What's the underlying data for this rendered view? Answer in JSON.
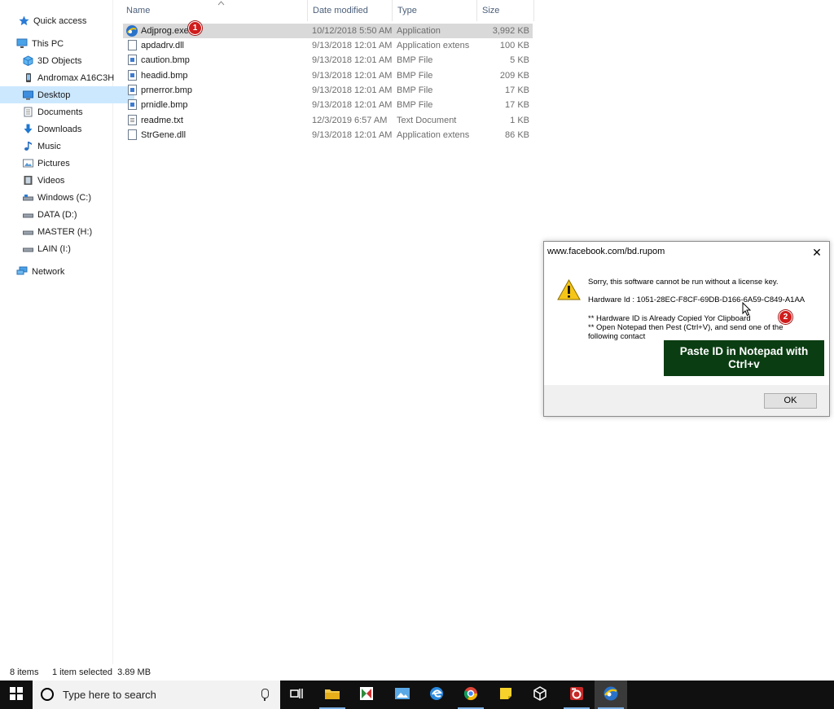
{
  "nav": {
    "items": [
      {
        "label": "Quick access",
        "icon": "star-icon"
      },
      {
        "label": "This PC",
        "icon": "computer-icon"
      },
      {
        "label": "3D Objects",
        "icon": "cube-icon"
      },
      {
        "label": "Andromax A16C3H",
        "icon": "phone-icon"
      },
      {
        "label": "Desktop",
        "icon": "desktop-icon",
        "selected": true
      },
      {
        "label": "Documents",
        "icon": "document-icon"
      },
      {
        "label": "Downloads",
        "icon": "download-arrow-icon"
      },
      {
        "label": "Music",
        "icon": "music-note-icon"
      },
      {
        "label": "Pictures",
        "icon": "pictures-icon"
      },
      {
        "label": "Videos",
        "icon": "film-icon"
      },
      {
        "label": "Windows (C:)",
        "icon": "drive-icon"
      },
      {
        "label": "DATA (D:)",
        "icon": "drive-icon"
      },
      {
        "label": "MASTER (H:)",
        "icon": "drive-icon"
      },
      {
        "label": "LAIN (I:)",
        "icon": "drive-icon"
      },
      {
        "label": "Network",
        "icon": "network-icon"
      }
    ]
  },
  "files": {
    "columns": {
      "name": "Name",
      "date": "Date modified",
      "type": "Type",
      "size": "Size"
    },
    "rows": [
      {
        "name": "Adjprog.exe",
        "date": "10/12/2018 5:50 AM",
        "type": "Application",
        "size": "3,992 KB",
        "icon": "app-icon",
        "selected": true
      },
      {
        "name": "apdadrv.dll",
        "date": "9/13/2018 12:01 AM",
        "type": "Application extens",
        "size": "100 KB",
        "icon": "dll-icon"
      },
      {
        "name": "caution.bmp",
        "date": "9/13/2018 12:01 AM",
        "type": "BMP File",
        "size": "5 KB",
        "icon": "bmp-icon"
      },
      {
        "name": "headid.bmp",
        "date": "9/13/2018 12:01 AM",
        "type": "BMP File",
        "size": "209 KB",
        "icon": "bmp-icon"
      },
      {
        "name": "prnerror.bmp",
        "date": "9/13/2018 12:01 AM",
        "type": "BMP File",
        "size": "17 KB",
        "icon": "bmp-icon"
      },
      {
        "name": "prnidle.bmp",
        "date": "9/13/2018 12:01 AM",
        "type": "BMP File",
        "size": "17 KB",
        "icon": "bmp-icon"
      },
      {
        "name": "readme.txt",
        "date": "12/3/2019 6:57 AM",
        "type": "Text Document",
        "size": "1 KB",
        "icon": "txt-icon"
      },
      {
        "name": "StrGene.dll",
        "date": "9/13/2018 12:01 AM",
        "type": "Application extens",
        "size": "86 KB",
        "icon": "dll-icon"
      }
    ]
  },
  "annotations": {
    "badge1": "1",
    "badge2": "2"
  },
  "status": {
    "items": "8 items",
    "selected": "1 item selected  3.89 MB"
  },
  "dialog": {
    "title": "www.facebook.com/bd.rupom",
    "message": "Sorry, this software cannot be run without a license key.",
    "hardware_id": "Hardware Id : 1051-28EC-F8CF-69DB-D166-6A59-C849-A1AA",
    "note1": "** Hardware ID is Already Copied Yor Clipboard",
    "note2": "** Open Notepad then Pest (Ctrl+V),  and send one of the",
    "note3": "following contact",
    "ok_label": "OK",
    "callout": "Paste ID in Notepad with Ctrl+v",
    "icon": "warning-icon"
  },
  "taskbar": {
    "search_placeholder": "Type here to search",
    "apps": [
      "task-view-icon",
      "file-explorer-icon",
      "app-icon",
      "photos-icon",
      "edge-icon",
      "chrome-icon",
      "sticky-notes-icon",
      "3d-viewer-icon",
      "recorder-icon",
      "adjprog-icon"
    ]
  },
  "colors": {
    "selection": "#cce8ff",
    "file_selected": "#d9d9d9",
    "callout_bg": "#0b3d12",
    "badge": "#d01d1d",
    "taskbar": "#101010"
  }
}
